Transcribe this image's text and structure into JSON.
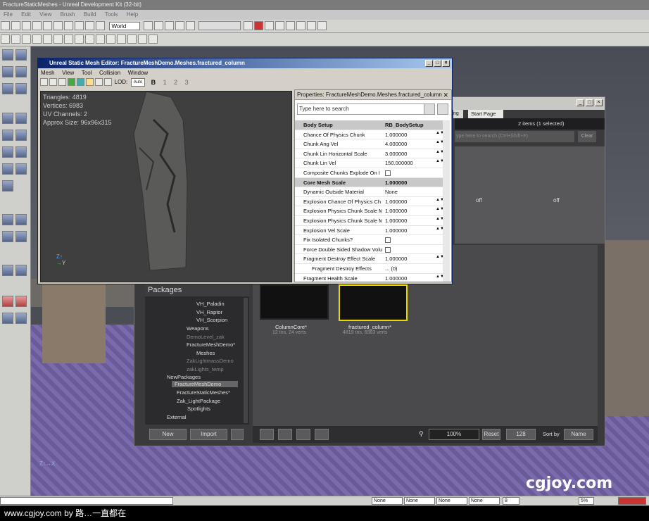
{
  "app": {
    "title": "FractureStaticMeshes - Unreal Development Kit (32-bit)",
    "menu": [
      "File",
      "Edit",
      "View",
      "Brush",
      "Build",
      "Tools",
      "Help"
    ],
    "world_select": "World"
  },
  "mesh_editor": {
    "title": "Unreal Static Mesh Editor: FractureMeshDemo.Meshes.fractured_column",
    "menu": [
      "Mesh",
      "View",
      "Tool",
      "Collision",
      "Window"
    ],
    "lod_label": "LOD:",
    "lod_auto": "Auto",
    "lod_buttons": [
      "B",
      "1",
      "2",
      "3"
    ],
    "stats": {
      "triangles": "Triangles:  4819",
      "vertices": "Vertices:  6983",
      "uv_channels": "UV Channels:  2",
      "approx_size": "Approx Size:  96x96x315"
    }
  },
  "properties": {
    "title": "Properties: FractureMeshDemo.Meshes.fractured_column",
    "search_placeholder": "Type here to search",
    "rows": [
      {
        "name": "Body Setup",
        "value": "RB_BodySetup",
        "type": "category"
      },
      {
        "name": "Chance Of Physics Chunk",
        "value": "1.000000",
        "type": "num"
      },
      {
        "name": "Chunk Ang Vel",
        "value": "4.000000",
        "type": "num"
      },
      {
        "name": "Chunk Lin Horizontal Scale",
        "value": "3.000000",
        "type": "num"
      },
      {
        "name": "Chunk Lin Vel",
        "value": "150.000000",
        "type": "num"
      },
      {
        "name": "Composite Chunks Explode On I",
        "value": "",
        "type": "check"
      },
      {
        "name": "Core Mesh Scale",
        "value": "1.000000",
        "type": "highlight"
      },
      {
        "name": "Dynamic Outside Material",
        "value": "None",
        "type": "obj"
      },
      {
        "name": "Explosion Chance Of Physics Ch",
        "value": "1.000000",
        "type": "num"
      },
      {
        "name": "Explosion Physics Chunk Scale M",
        "value": "1.000000",
        "type": "num"
      },
      {
        "name": "Explosion Physics Chunk Scale M",
        "value": "1.000000",
        "type": "num"
      },
      {
        "name": "Explosion Vel Scale",
        "value": "1.000000",
        "type": "num"
      },
      {
        "name": "Fix Isolated Chunks?",
        "value": "",
        "type": "check"
      },
      {
        "name": "Force Double Sided Shadow Volu",
        "value": "",
        "type": "check"
      },
      {
        "name": "Fragment Destroy Effect Scale",
        "value": "1.000000",
        "type": "num"
      },
      {
        "name": "Fragment Destroy Effects",
        "value": "... (0)",
        "type": "array"
      },
      {
        "name": "Fragment Health Scale",
        "value": "1.000000",
        "type": "num"
      }
    ]
  },
  "content_browser": {
    "tab": "Start Page",
    "tab_partial": "ng",
    "items_selected": "2 items (1 selected)",
    "search_placeholder": "ype here to search  (Ctrl+Shift+F)",
    "clear": "Clear",
    "off_labels": [
      "off",
      "off"
    ],
    "packages_header": "Packages",
    "tree": [
      {
        "label": "VH_Paladin",
        "dim": false
      },
      {
        "label": "VH_Raptor",
        "dim": false
      },
      {
        "label": "VH_Scorpion",
        "dim": false
      },
      {
        "label": "Weapons",
        "dim": false
      },
      {
        "label": "DemoLevel_zak",
        "dim": true
      },
      {
        "label": "FractureMeshDemo*",
        "dim": false
      },
      {
        "label": "Meshes",
        "dim": false
      },
      {
        "label": "ZakLightmassDemo",
        "dim": true
      },
      {
        "label": "zakLights_temp",
        "dim": true
      },
      {
        "label": "NewPackages",
        "dim": false
      },
      {
        "label": "FractureMeshDemo",
        "dim": false
      },
      {
        "label": "FractureStaticMeshes*",
        "dim": false
      },
      {
        "label": "Zak_LightPackage",
        "dim": false
      },
      {
        "label": "Spotlights",
        "dim": false
      },
      {
        "label": "External",
        "dim": false
      }
    ],
    "assets": [
      {
        "name": "ColumnCore*",
        "info": "12 tris, 24 verts"
      },
      {
        "name": "fractured_column*",
        "info": "4819 tris, 6983 verts"
      }
    ],
    "new_button": "New",
    "import_button": "Import",
    "zoom": "100%",
    "reset": "Reset",
    "size": "128",
    "sort_label": "Sort by",
    "sort_value": "Name"
  },
  "status_bar": {
    "fields": [
      "None",
      "None",
      "None",
      "None"
    ],
    "grid": "8",
    "percent": "5%"
  },
  "watermark": "cgjoy.com",
  "footer": "www.cgjoy.com by 路…一直都在"
}
